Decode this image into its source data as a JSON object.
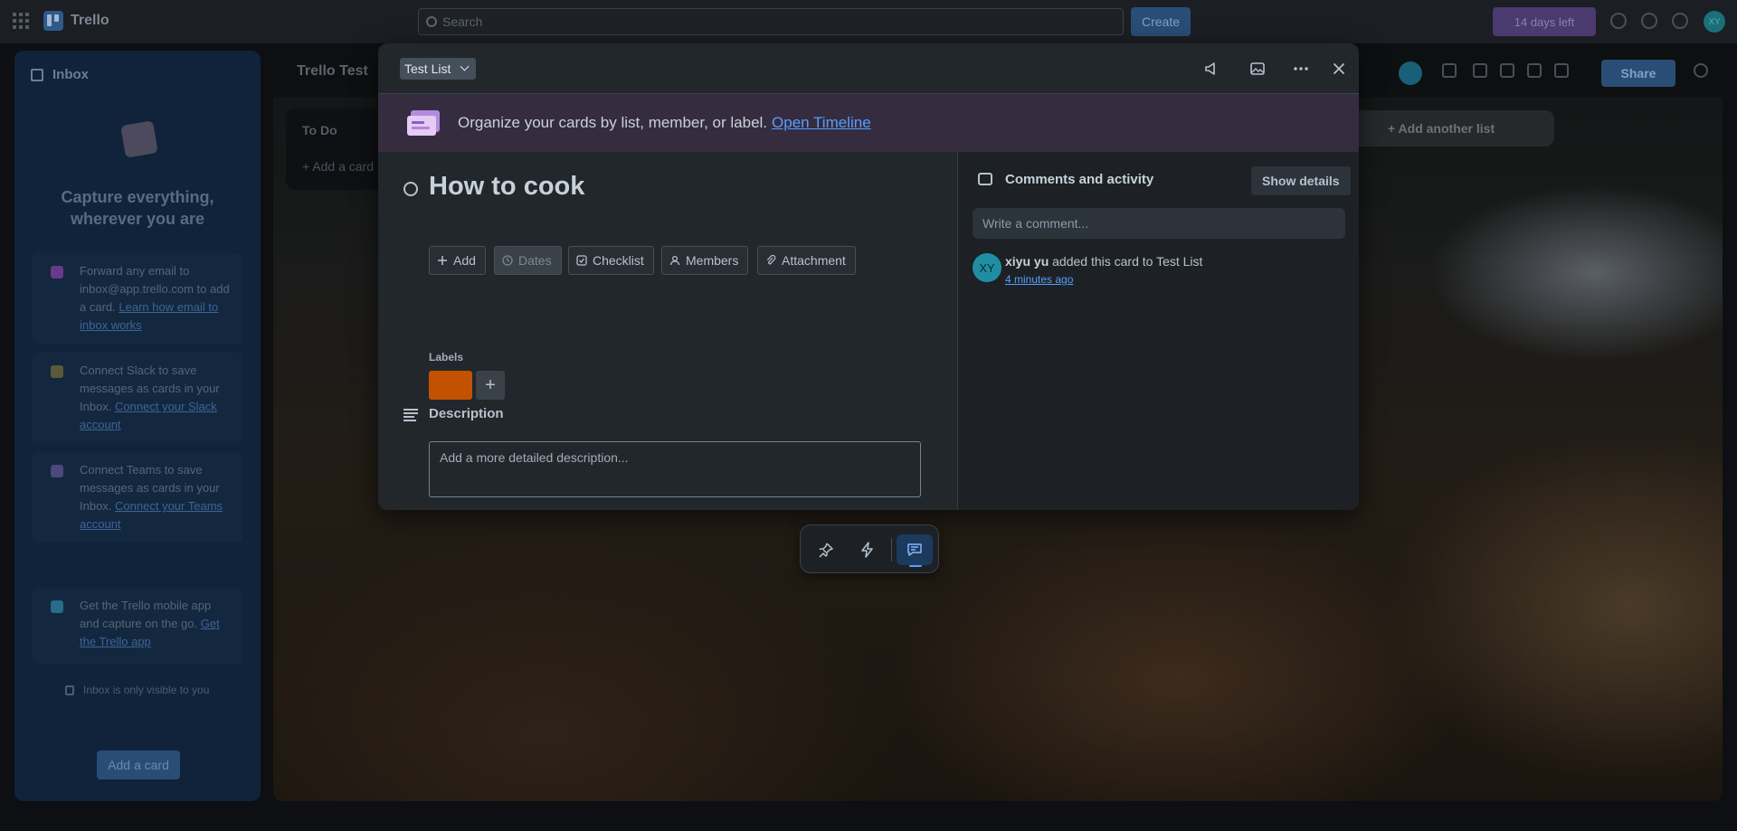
{
  "topnav": {
    "brand": "Trello",
    "search_placeholder": "Search",
    "create_label": "Create",
    "trial_label": "14 days left",
    "avatar_initials": "XY"
  },
  "inbox": {
    "title": "Inbox",
    "heading": "Capture everything, wherever you are",
    "cards": [
      {
        "text": "Forward any email to inbox@app.trello.com to add a card.",
        "link": "Learn how email to inbox works",
        "icon": "email-icon",
        "color": "#6a3a8a"
      },
      {
        "text": "Connect Slack to save messages as cards in your Inbox.",
        "link": "Connect your Slack account",
        "icon": "slack-icon",
        "color": "#5a5a3a"
      },
      {
        "text": "Connect Teams to save messages as cards in your Inbox.",
        "link": "Connect your Teams account",
        "icon": "teams-icon",
        "color": "#4a4a7a"
      },
      {
        "text": "Get the Trello mobile app and capture on the go.",
        "link": "Get the Trello app",
        "icon": "mobile-icon",
        "color": "#2a6a8a"
      }
    ],
    "privacy": "Inbox is only visible to you",
    "add_card_label": "Add a card"
  },
  "board": {
    "title": "Trello Test",
    "list_title": "To Do",
    "list_add_card": "+ Add a card",
    "add_list_label": "+ Add another list",
    "share_label": "Share"
  },
  "modal": {
    "list_name": "Test List",
    "banner_text": "Organize your cards by list, member, or label.",
    "banner_link": "Open Timeline",
    "card_title": "How to cook",
    "actions": [
      {
        "label": "Add",
        "name": "add-button",
        "icon": "plus-icon"
      },
      {
        "label": "Dates",
        "name": "dates-button",
        "icon": "clock-icon"
      },
      {
        "label": "Checklist",
        "name": "checklist-button",
        "icon": "checkbox-icon"
      },
      {
        "label": "Members",
        "name": "members-button",
        "icon": "person-icon"
      },
      {
        "label": "Attachment",
        "name": "attachment-button",
        "icon": "paperclip-icon"
      }
    ],
    "labels_title": "Labels",
    "label_color": "#c25100",
    "description_title": "Description",
    "description_placeholder": "Add a more detailed description...",
    "activity_title": "Comments and activity",
    "show_details_label": "Show details",
    "comment_placeholder": "Write a comment...",
    "activity": {
      "avatar_initials": "XY",
      "user": "xiyu yu",
      "action": "added this card to Test List",
      "time": "4 minutes ago"
    }
  },
  "colors": {
    "accent": "#579dff",
    "modal_bg": "#22272b",
    "banner_bg": "#352c3f"
  }
}
